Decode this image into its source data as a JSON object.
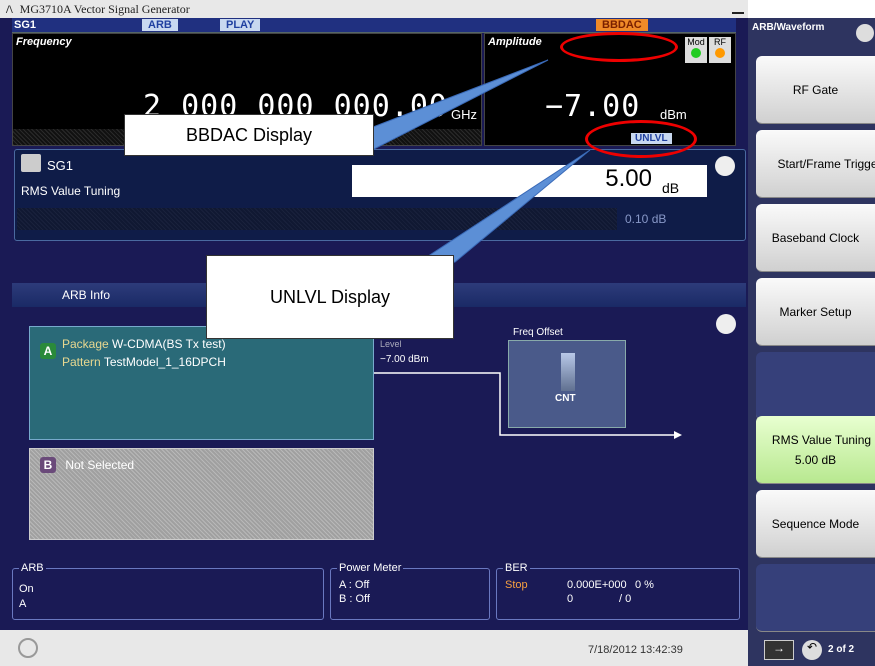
{
  "window": {
    "title": "MG3710A  Vector Signal Generator",
    "logo": "/\\"
  },
  "status": {
    "sg": "SG1",
    "arb": "ARB",
    "play": "PLAY",
    "bbdac": "BBDAC"
  },
  "frequency": {
    "label": "Frequency",
    "value": "2 000 000 000.00",
    "unit": "GHz"
  },
  "amplitude": {
    "label": "Amplitude",
    "value": "−7.00",
    "unit": "dBm",
    "mod": "Mod",
    "rf": "RF",
    "unlvl": "UNLVL"
  },
  "tuning": {
    "sg": "SG1",
    "label": "RMS Value Tuning",
    "value": "5.00",
    "unit": "dB",
    "step": "0.10 dB"
  },
  "arb_info": {
    "header": "ARB Info"
  },
  "package_a": {
    "letter": "A",
    "package_label": "Package",
    "package_value": "W-CDMA(BS Tx test)",
    "pattern_label": "Pattern",
    "pattern_value": "TestModel_1_16DPCH",
    "level_label": "Level",
    "level_value": "−7.00 dBm"
  },
  "package_b": {
    "letter": "B",
    "text": "Not Selected"
  },
  "freq_offset": {
    "label": "Freq Offset",
    "cnt": "CNT"
  },
  "bottom": {
    "arb": {
      "title": "ARB",
      "line1": "On",
      "line2": "A"
    },
    "power": {
      "title": "Power Meter",
      "a": "A :  Off",
      "b": "B :  Off"
    },
    "ber": {
      "title": "BER",
      "status": "Stop",
      "value": "0.000E+000",
      "pct": "0 %",
      "count1": "0",
      "count2": "/ 0"
    }
  },
  "footer": {
    "datetime": "7/18/2012 13:42:39",
    "page": "2 of 2"
  },
  "side": {
    "title": "ARB/Waveform",
    "keys": [
      {
        "label": "RF Gate"
      },
      {
        "label": "Start/Frame Trigger"
      },
      {
        "label": "Baseband Clock"
      },
      {
        "label": "Marker Setup"
      },
      {
        "label": ""
      },
      {
        "label": "RMS Value Tuning",
        "sub": "5.00 dB"
      },
      {
        "label": "Sequence Mode"
      },
      {
        "label": ""
      }
    ]
  },
  "callouts": {
    "bbdac": "BBDAC Display",
    "unlvl": "UNLVL Display"
  },
  "colors": {
    "accent": "#1a1a55",
    "highlight": "#b8e890",
    "alert": "#e00000"
  }
}
